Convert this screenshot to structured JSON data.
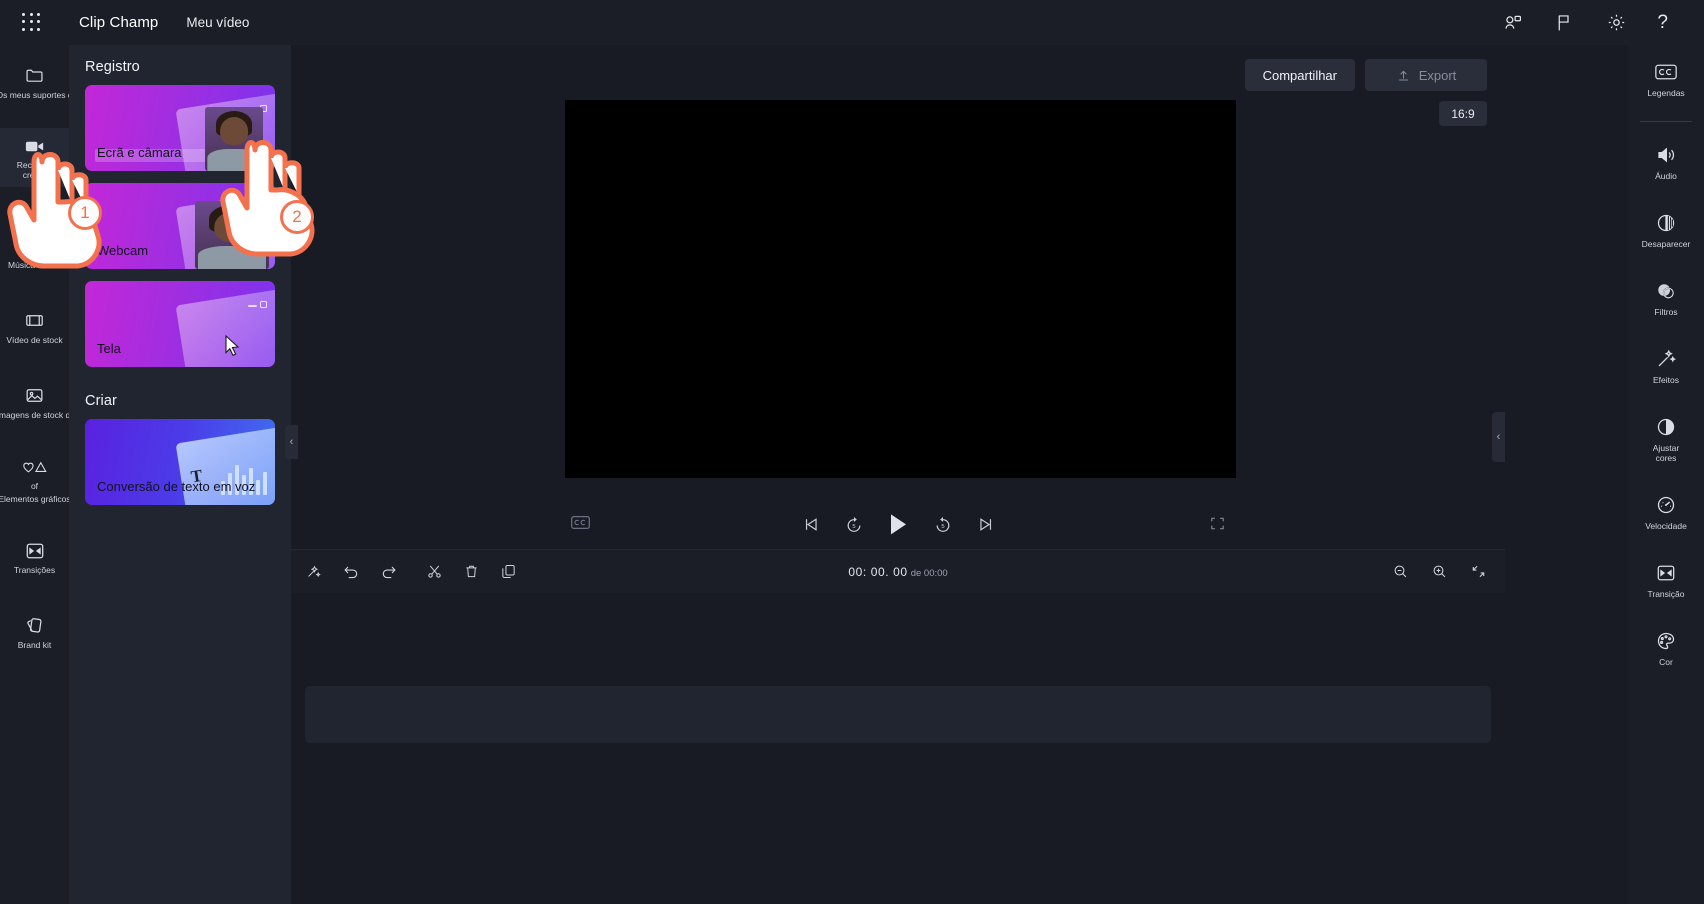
{
  "app": {
    "brand": "Clip Champ",
    "project_name": "Meu vídeo",
    "bg": "#181b24",
    "accent": "#f4714e"
  },
  "topbar": {
    "waffle_icon": "grid-apps-icon",
    "icons": [
      {
        "name": "people-share-icon",
        "glyph": "people"
      },
      {
        "name": "flag-feedback-icon",
        "glyph": "flag"
      },
      {
        "name": "gear-settings-icon",
        "glyph": "gear"
      },
      {
        "name": "help-icon",
        "glyph": "?"
      }
    ]
  },
  "left_rail": {
    "items": [
      {
        "label": "Os meus suportes de dados",
        "icon": "folder-icon",
        "selected": false
      },
      {
        "label": "Record & create",
        "label_line1": "Record &",
        "label_line2": "create",
        "icon": "video-camera-icon",
        "selected": true
      },
      {
        "label": "Música e SFX",
        "icon": "music-note-icon",
        "selected": false
      },
      {
        "label": "Vídeo de stock",
        "icon": "film-strip-icon",
        "selected": false
      },
      {
        "label": "Imagens de stock de",
        "icon": "image-icon",
        "selected": false
      },
      {
        "label": "Elementos gráficos",
        "sub": "of",
        "icon": "shapes-heart-triangle-icon",
        "selected": false
      },
      {
        "label": "Transições",
        "icon": "transition-icon",
        "selected": false
      },
      {
        "label": "Brand kit",
        "icon": "brand-cards-icon",
        "selected": false
      }
    ]
  },
  "panel": {
    "section_record": "Registro",
    "section_create": "Criar",
    "cards": [
      {
        "label": "Ecrã e câmara",
        "art": "screen-and-camera"
      },
      {
        "label": "Webcam",
        "art": "webcam"
      },
      {
        "label": "Tela",
        "art": "screen"
      }
    ],
    "create_cards": [
      {
        "label": "Conversão de texto em voz",
        "art": "text-to-speech"
      }
    ],
    "collapse_left": "‹",
    "collapse_right": "‹"
  },
  "stage": {
    "share_label": "Compartilhar",
    "export_label": "Export",
    "export_icon": "upload-icon",
    "aspect_ratio": "16:9",
    "preview_bg": "#000000"
  },
  "playback": {
    "captions_icon": "closed-captions-icon",
    "prev_icon": "skip-to-start-icon",
    "back5_icon": "rewind-5s-icon",
    "play_icon": "play-icon",
    "fwd5_icon": "forward-5s-icon",
    "next_icon": "skip-to-end-icon",
    "fullscreen_icon": "fullscreen-icon"
  },
  "timeline": {
    "tools": [
      {
        "name": "magic-wand-icon",
        "label": "magic"
      },
      {
        "name": "undo-icon",
        "label": "undo"
      },
      {
        "name": "redo-icon",
        "label": "redo"
      },
      {
        "name": "scissors-split-icon",
        "label": "split"
      },
      {
        "name": "trash-delete-icon",
        "label": "delete"
      },
      {
        "name": "duplicate-copy-icon",
        "label": "duplicate"
      }
    ],
    "current_time": "00: 00. 00",
    "total_separator": "/",
    "total_time": "de 00:00",
    "zoom_tools": [
      {
        "name": "zoom-out-icon"
      },
      {
        "name": "zoom-in-icon"
      },
      {
        "name": "fit-to-screen-icon"
      }
    ]
  },
  "right_rail": {
    "items": [
      {
        "label": "Legendas",
        "icon": "closed-captions-icon",
        "divider_after": true
      },
      {
        "label": "Áudio",
        "icon": "speaker-volume-icon",
        "divider_after": false
      },
      {
        "label": "Desaparecer",
        "icon": "fade-icon",
        "divider_after": false
      },
      {
        "label": "Filtros",
        "icon": "filters-circles-icon",
        "divider_after": false
      },
      {
        "label": "Efeitos",
        "icon": "magic-wand-sparkle-icon",
        "divider_after": false
      },
      {
        "label": "Ajustar cores",
        "label_line1": "Ajustar",
        "label_line2": "cores",
        "icon": "contrast-half-circle-icon",
        "divider_after": false
      },
      {
        "label": "Velocidade",
        "icon": "speedometer-icon",
        "divider_after": false
      },
      {
        "label": "Transição",
        "icon": "transition-icon",
        "divider_after": false
      },
      {
        "label": "Cor",
        "icon": "color-palette-icon",
        "divider_after": false
      }
    ]
  },
  "tutorial": {
    "steps": [
      {
        "number": "1",
        "target": "record-and-create-rail-item"
      },
      {
        "number": "2",
        "target": "screen-and-camera-card"
      }
    ],
    "cursor_icon": "mouse-pointer-icon"
  }
}
